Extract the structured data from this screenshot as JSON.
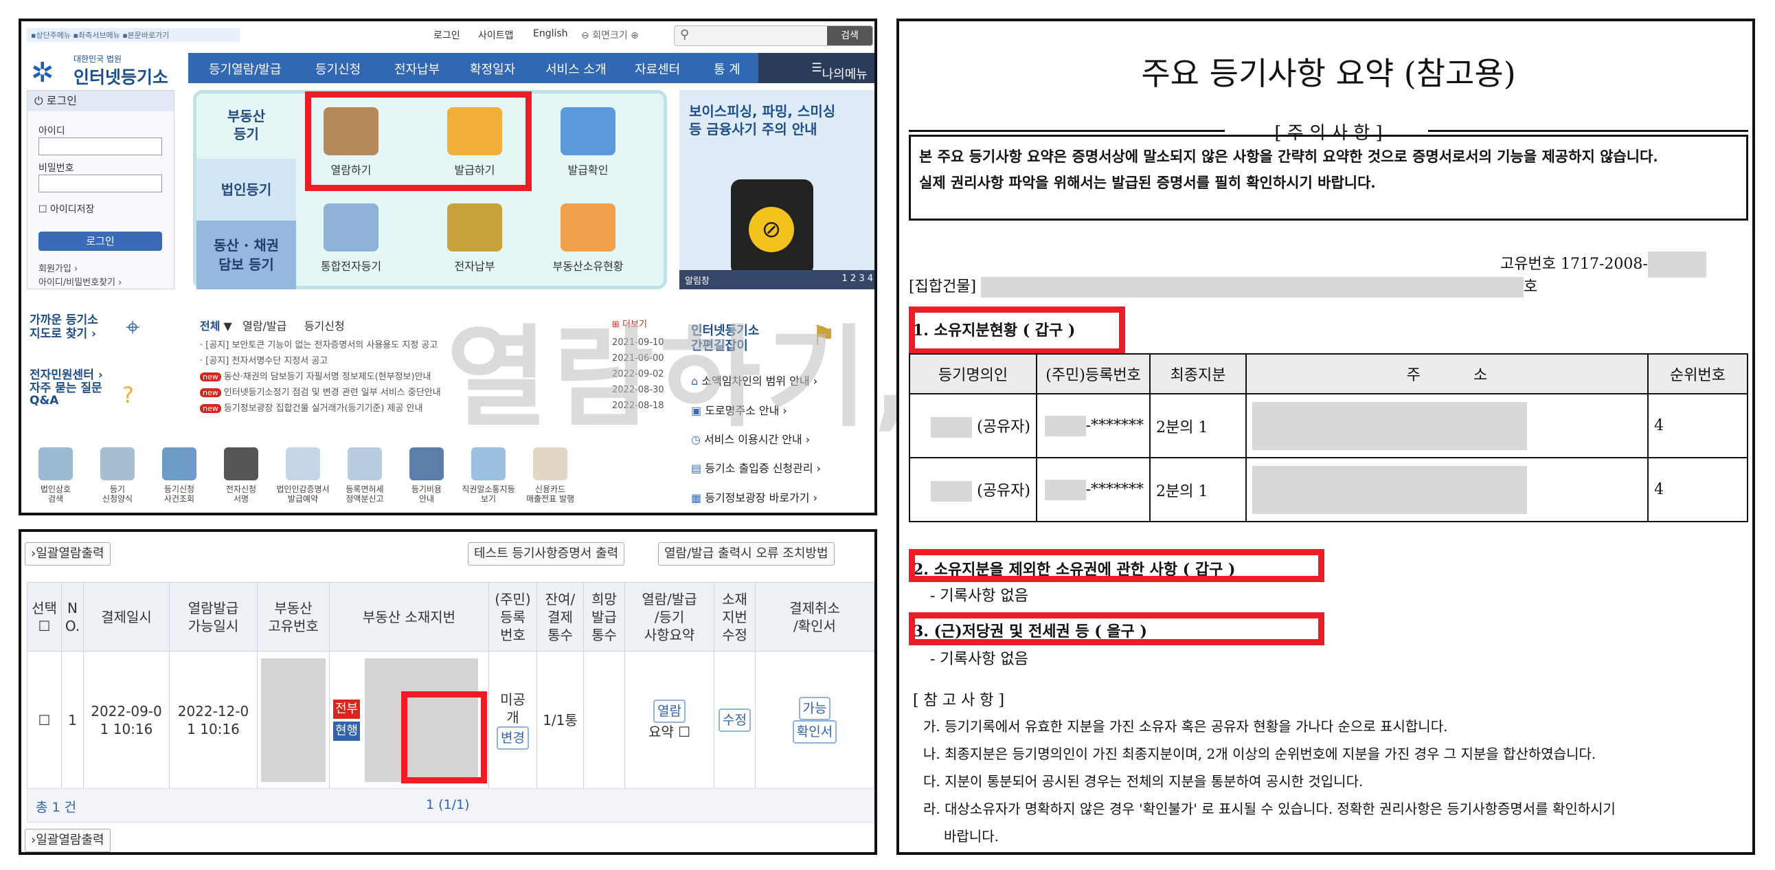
{
  "left_top": {
    "skip_links": "▪상단주메뉴 ▪좌측서브메뉴 ▪본문바로가기",
    "util": {
      "login": "로그인",
      "sitemap": "사이트맵",
      "english": "English",
      "zoom": "회면크기",
      "search_btn": "검색"
    },
    "logo": {
      "sub": "대한민국 법원",
      "main": "인터넷등기소"
    },
    "nav": [
      "등기열람/발급",
      "등기신청",
      "전자납부",
      "확정일자",
      "서비스 소개",
      "자료센터",
      "통 계"
    ],
    "my_menu": "나의메뉴",
    "login_box": {
      "title": "로그인",
      "id_label": "아이디",
      "pw_label": "비밀번호",
      "save_id": "아이디저장",
      "login_btn": "로그인",
      "join": "회원가입 ›",
      "find": "아이디/비밀번호찾기 ›"
    },
    "categories": {
      "realestate": "부동산\n등기",
      "corp": "법인등기",
      "movable": "동산 · 채권\n담보 등기"
    },
    "icons": [
      "열람하기",
      "발급하기",
      "발급확인",
      "통합전자등기",
      "전자납부",
      "부동산소유현황"
    ],
    "banner": {
      "title": "보이스피싱, 파밍, 스미싱\n등 금융사기 주의 안내",
      "bar_label": "알림창",
      "pages": "1 2 3 4"
    },
    "left_links": {
      "nearby": "가까운 등기소\n지도로 찾기 ›",
      "civil": "전자민원센터 ›",
      "faq": "자주 묻는 질문\nQ&A"
    },
    "notice_tabs": {
      "all": "전체",
      "view": "열람/발급",
      "apply": "등기신청",
      "more": "더보기"
    },
    "notices": [
      {
        "text": "· [공지] 보안토큰 기능이 없는 전자증명서의 사용용도 지정 공고",
        "date": "2021-09-10",
        "new": false
      },
      {
        "text": "· [공지] 전자서명수단 지정서 공고",
        "date": "2021-06-00",
        "new": false
      },
      {
        "text": "동산·채권의 담보등기 자필서명 정보제도(현부정보)안내",
        "date": "2022-09-02",
        "new": true
      },
      {
        "text": "인터넷등기소정기 점검 및 변경 관련 일부 서비스 중단안내",
        "date": "2022-08-30",
        "new": true
      },
      {
        "text": "등기정보광장 집합건물 실거래가(등기기준) 제공 안내",
        "date": "2022-08-18",
        "new": true
      }
    ],
    "new_badge": "new",
    "guide": "인터넷등기소\n간편길잡이",
    "quick_links": [
      "소액임차인의 범위 안내 ›",
      "도로명주소 안내 ›",
      "서비스 이용시간 안내 ›",
      "등기소 출입증 신청관리 ›",
      "등기정보광장 바로가기 ›"
    ],
    "bottom_icons": [
      "법인상호\n검색",
      "등기\n신청양식",
      "등기신청\n사건조회",
      "전자신청\n서명",
      "법인인감증명서\n발급예약",
      "등록면허세\n정액분신고",
      "등기비용\n안내",
      "직권말소통지등\n보기",
      "신용카드\n매출전표 발행"
    ],
    "watermark": "열람하기, 발급하기 서류"
  },
  "left_bottom": {
    "btn_batch": "›일괄열람출력",
    "btn_test": "테스트 등기사항증명서 출력",
    "btn_error": "열람/발급 출력시 오류 조치방법",
    "headers": [
      "선택",
      "N\nO.",
      "결제일시",
      "열람발급\n가능일시",
      "부동산\n고유번호",
      "부동산 소재지번",
      "(주민)\n등록\n번호",
      "잔여/\n결제\n통수",
      "희망\n발급\n통수",
      "열람/발급\n/등기\n사항요약",
      "소재\n지번\n수정",
      "결제취소\n/확인서"
    ],
    "row": {
      "no": "1",
      "paid": "2022-09-0\n1 10:16",
      "avail": "2022-12-0\n1 10:16",
      "tag1": "전부",
      "tag2": "현행",
      "reg_status": "미공\n개",
      "reg_btn": "변경",
      "count": "1/1통",
      "view_btn": "열람",
      "summary_label": "요약",
      "fix_btn": "수정",
      "ok_btn": "가능",
      "cert_btn": "확인서"
    },
    "total": "총 1 건",
    "pager": "1 (1/1)",
    "btn_batch2": "›일괄열람출력"
  },
  "right": {
    "title": "주요 등기사항 요약 (참고용)",
    "caution_title": "[ 주 의 사 항 ]",
    "caution_text": "본 주요 등기사항 요약은 증명서상에 말소되지 않은 사항을 간략히 요약한 것으로 증명서로서의 기능을 제공하지 않습니다.\n실제 권리사항 파악을 위해서는 발급된 증명서를 필히 확인하시기 바랍니다.",
    "unique_no": "고유번호 1717-2008-",
    "building": "[집합건물]",
    "building_suffix": "호",
    "sec1": "1. 소유지분현황 ( 갑구 )",
    "table_headers": [
      "등기명의인",
      "(주민)등록번호",
      "최종지분",
      "주           소",
      "순위번호"
    ],
    "rows": [
      {
        "holder": "(공유자)",
        "reg": "-*******",
        "share": "2분의 1",
        "rank": "4"
      },
      {
        "holder": "(공유자)",
        "reg": "-*******",
        "share": "2분의 1",
        "rank": "4"
      }
    ],
    "sec2": "2. 소유지분을 제외한 소유권에 관한 사항 ( 갑구 )",
    "sec2_note": "- 기록사항 없음",
    "sec3": "3. (근)저당권 및 전세권 등 ( 을구 )",
    "sec3_note": "- 기록사항 없음",
    "ref_title": "[ 참 고 사 항 ]",
    "refs": [
      "가. 등기기록에서 유효한 지분을 가진 소유자 혹은 공유자 현황을 가나다 순으로 표시합니다.",
      "나. 최종지분은 등기명의인이 가진 최종지분이며, 2개 이상의 순위번호에 지분을 가진 경우 그 지분을 합산하였습니다.",
      "다. 지분이 통분되어 공시된 경우는 전체의 지분을 통분하여 공시한 것입니다.",
      "라. 대상소유자가 명확하지 않은 경우 '확인불가' 로 표시될 수 있습니다. 정확한 권리사항은 등기사항증명서를 확인하시기",
      "바랍니다."
    ]
  },
  "colors": {
    "highlight": "#ee1c25",
    "nav_blue": "#3267b3",
    "mint": "#e4f6f6"
  }
}
